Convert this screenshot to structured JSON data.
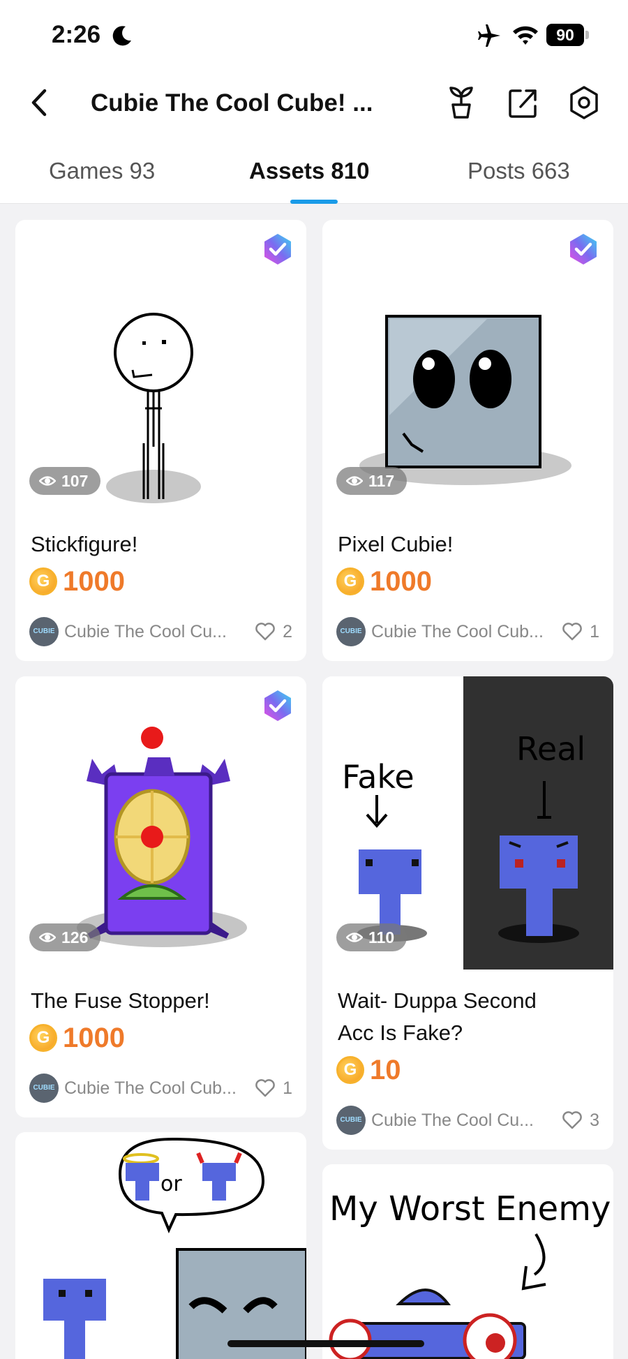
{
  "status_bar": {
    "time": "2:26",
    "battery": "90"
  },
  "header": {
    "title": "Cubie The Cool Cube! ..."
  },
  "tabs": [
    {
      "label": "Games 93",
      "active": false
    },
    {
      "label": "Assets 810",
      "active": true
    },
    {
      "label": "Posts 663",
      "active": false
    }
  ],
  "cards": [
    {
      "name": "Stickfigure!",
      "views": "107",
      "price": "1000",
      "creator": "Cubie The Cool Cu...",
      "likes": "2",
      "verified": true
    },
    {
      "name": "Pixel Cubie!",
      "views": "117",
      "price": "1000",
      "creator": "Cubie The Cool Cub...",
      "likes": "1",
      "verified": true
    },
    {
      "name": "The Fuse Stopper!",
      "views": "126",
      "price": "1000",
      "creator": "Cubie The Cool Cub...",
      "likes": "1",
      "verified": true
    },
    {
      "name_line1": "Wait- Duppa Second",
      "name_line2": "Acc Is Fake?",
      "views": "110",
      "price": "10",
      "creator": "Cubie The Cool Cu...",
      "likes": "3",
      "verified": false,
      "art_text_left": "Fake",
      "art_text_right": "Real"
    },
    {
      "art_text": "or"
    },
    {
      "art_text": "My Worst Enemy"
    }
  ],
  "coin_symbol": "G",
  "avatar_text": "CUBIE",
  "colors": {
    "accent_tab": "#1a9be8",
    "price": "#ef7a2a",
    "views_pill": "#787878"
  }
}
